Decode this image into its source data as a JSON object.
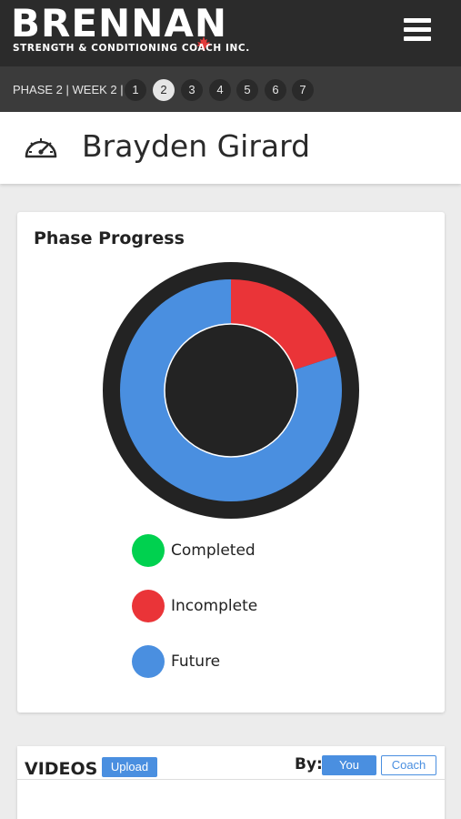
{
  "app": {
    "logo_main": "BRENNAN",
    "logo_sub": "STRENGTH & CONDITIONING COACH INC.",
    "menu_icon": "hamburger-menu-icon"
  },
  "phase_nav": {
    "label": "PHASE 2 | WEEK 2 |",
    "weeks": [
      "1",
      "2",
      "3",
      "4",
      "5",
      "6",
      "7"
    ],
    "active_week": "2"
  },
  "athlete": {
    "icon": "speedometer-icon",
    "name": "Brayden Girard"
  },
  "progress_card": {
    "title": "Phase Progress",
    "legend": [
      {
        "label": "Completed",
        "color": "#00d14f"
      },
      {
        "label": "Incomplete",
        "color": "#ea3438"
      },
      {
        "label": "Future",
        "color": "#4a8fe0"
      }
    ]
  },
  "chart_data": {
    "type": "pie",
    "variant": "donut",
    "categories": [
      "Completed",
      "Incomplete",
      "Future"
    ],
    "values": [
      0,
      20,
      80
    ],
    "colors": [
      "#00d14f",
      "#ea3438",
      "#4a8fe0"
    ],
    "title": "Phase Progress",
    "legend_position": "bottom"
  },
  "videos": {
    "title": "VIDEOS",
    "upload_label": "Upload",
    "by_label": "By:",
    "you_label": "You",
    "coach_label": "Coach",
    "selected": "You"
  },
  "colors": {
    "topbar": "#2b2b2b",
    "phasebar": "#3b3b3b",
    "accent": "#4a8fe0",
    "donut_ring": "#232323"
  }
}
